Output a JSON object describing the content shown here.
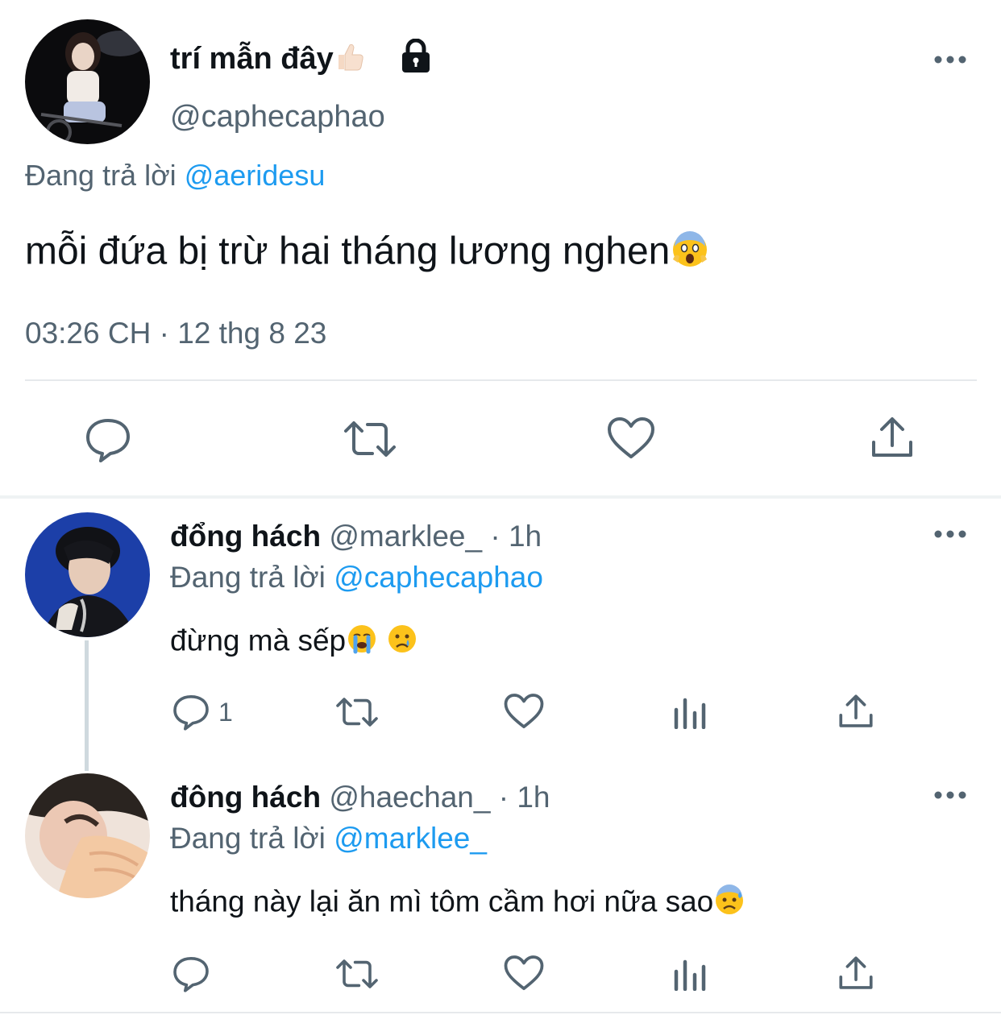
{
  "main_tweet": {
    "display_name": "trí mẫn đây",
    "handle": "@caphecaphao",
    "reply_prefix": "Đang trả lời",
    "reply_to": "@aeridesu",
    "text": "mỗi đứa bị trừ hai tháng lương nghen",
    "timestamp": "03:26 CH · 12 thg 8 23",
    "icons": [
      "thumbs-up-emoji",
      "lock-icon",
      "more-icon",
      "scream-emoji"
    ],
    "actions": [
      "reply-icon",
      "retweet-icon",
      "like-icon",
      "share-icon"
    ]
  },
  "replies": [
    {
      "display_name": "đổng hách",
      "handle": "@marklee_",
      "time": "· 1h",
      "reply_prefix": "Đang trả lời",
      "reply_to": "@caphecaphao",
      "text": "đừng mà sếp",
      "reply_count": "1",
      "icons": [
        "loudly-crying-emoji",
        "crying-emoji"
      ]
    },
    {
      "display_name": "đông hách",
      "handle": "@haechan_",
      "time": "· 1h",
      "reply_prefix": "Đang trả lời",
      "reply_to": "@marklee_",
      "text": "tháng này lại ăn mì tôm cầm hơi nữa sao",
      "reply_count": "",
      "icons": [
        "anxious-sweat-emoji"
      ]
    }
  ],
  "colors": {
    "text": "#0f1419",
    "secondary": "#536471",
    "link": "#1d9bf0",
    "divider": "#e6e9ec"
  }
}
